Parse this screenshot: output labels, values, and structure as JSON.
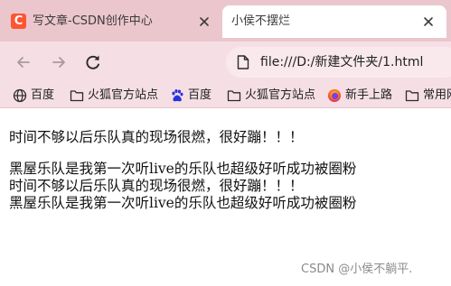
{
  "tabs": [
    {
      "title": "写文章-CSDN创作中心",
      "favicon_letter": "C",
      "active": false
    },
    {
      "title": "小侯不摆烂",
      "active": true
    }
  ],
  "address_bar": {
    "url": "file:///D:/新建文件夹/1.html"
  },
  "bookmarks": [
    {
      "label": "百度",
      "icon": "globe-icon"
    },
    {
      "label": "火狐官方站点",
      "icon": "folder-icon"
    },
    {
      "label": "百度",
      "icon": "baidu-paw-icon"
    },
    {
      "label": "火狐官方站点",
      "icon": "folder-icon"
    },
    {
      "label": "新手上路",
      "icon": "firefox-icon"
    },
    {
      "label": "常用网址",
      "icon": "folder-icon"
    }
  ],
  "content": {
    "paragraphs": [
      "时间不够以后乐队真的现场很燃，很好蹦！！！",
      "黑屋乐队是我第一次听live的乐队也超级好听成功被圈粉",
      "时间不够以后乐队真的现场很燃，很好蹦！！！",
      "黑屋乐队是我第一次听live的乐队也超级好听成功被圈粉"
    ]
  },
  "watermark": "CSDN @小侯不躺平.",
  "colors": {
    "tabstrip": "#ebc6cd",
    "toolbar": "#f5dfe4",
    "csdn_brand": "#fc5531",
    "baidu_blue": "#2932e1"
  }
}
